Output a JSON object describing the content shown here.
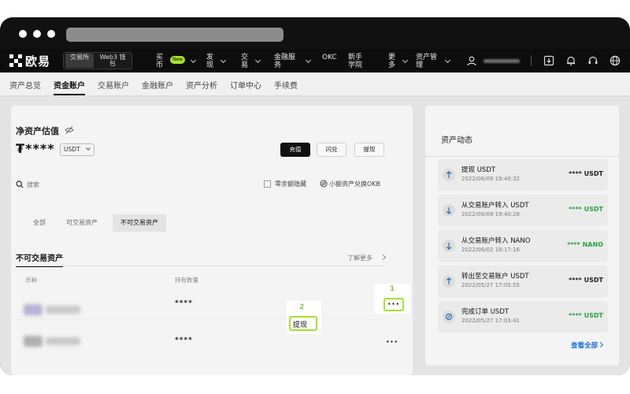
{
  "brand": {
    "name": "欧易"
  },
  "topnav": {
    "mode_exchange": "交易所",
    "mode_web3": "Web3 钱包",
    "buy_coin": "买币",
    "buy_badge": "New",
    "discover": "发现",
    "trade": "交易",
    "finance": "金融服务",
    "okc": "OKC",
    "academy": "新手学院",
    "more": "更多",
    "asset_mgmt": "资产管理"
  },
  "subnav": {
    "tabs": [
      "资产总览",
      "资金账户",
      "交易账户",
      "金融账户",
      "资产分析",
      "订单中心",
      "手续费"
    ]
  },
  "valuation": {
    "title": "净资产估值",
    "balance": "₮****",
    "currency": "USDT",
    "deposit": "充值",
    "convert": "闪兑",
    "withdraw": "提现"
  },
  "filters": {
    "search_placeholder": "搜索",
    "hide_zero": "零余额隐藏",
    "small_convert": "小额资产兑换OKB",
    "tabs": [
      "全部",
      "可交易资产",
      "不可交易资产"
    ]
  },
  "assets": {
    "title": "不可交易资产",
    "learn_more": "了解更多",
    "col_coin": "币种",
    "col_amount": "持有数量",
    "rows": [
      {
        "amount": "****",
        "more": "···"
      },
      {
        "amount": "****",
        "more": "···"
      }
    ],
    "dropdown_withdraw": "提现"
  },
  "callouts": {
    "first": "1",
    "second": "2"
  },
  "activity": {
    "title": "资产动态",
    "items": [
      {
        "title": "提现 USDT",
        "time": "2022/06/09 19:40:32",
        "amount": "**** USDT",
        "icon": "arrow-up-icon",
        "color": "#222222"
      },
      {
        "title": "从交易账户转入 USDT",
        "time": "2022/06/09 19:40:28",
        "amount": "**** USDT",
        "icon": "arrow-down-icon",
        "color": "#2ea043"
      },
      {
        "title": "从交易账户转入 NANO",
        "time": "2022/06/02 18:17:16",
        "amount": "**** NANO",
        "icon": "arrow-down-icon",
        "color": "#2ea043"
      },
      {
        "title": "转出至交易账户 USDT",
        "time": "2022/05/27 17:05:55",
        "amount": "**** USDT",
        "icon": "arrow-up-icon",
        "color": "#222222"
      },
      {
        "title": "完成订单 USDT",
        "time": "2022/05/27 17:03:41",
        "amount": "**** USDT",
        "icon": "order-icon",
        "color": "#2ea043"
      }
    ],
    "view_all": "查看全部"
  },
  "colors": {
    "accent": "#a6e22e",
    "link": "#1f6fd6",
    "positive": "#2ea043"
  }
}
